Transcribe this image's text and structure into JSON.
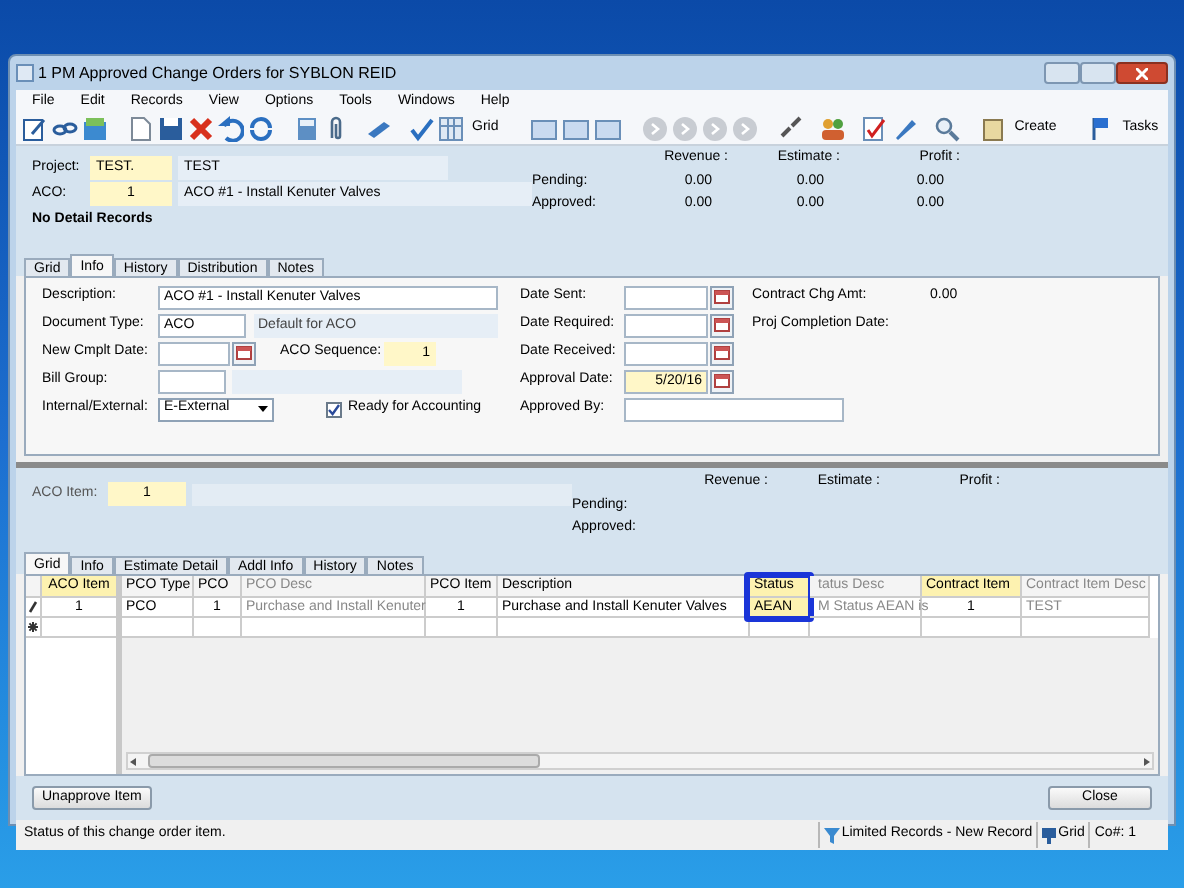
{
  "window": {
    "title": "1 PM Approved Change Orders for SYBLON REID"
  },
  "menu": [
    "File",
    "Edit",
    "Records",
    "View",
    "Options",
    "Tools",
    "Windows",
    "Help"
  ],
  "toolbar_labels": [
    "Grid",
    "Create",
    "Tasks"
  ],
  "header": {
    "project": {
      "label": "Project:",
      "code": "TEST.",
      "name": "TEST"
    },
    "aco": {
      "label": "ACO:",
      "code": "1",
      "name": "ACO #1 - Install Kenuter Valves"
    },
    "message": "No Detail Records",
    "totals": {
      "columns": [
        "Revenue :",
        "Estimate :",
        "Profit :"
      ],
      "rows": [
        {
          "label": "Pending:",
          "values": [
            "0.00",
            "0.00",
            "0.00"
          ]
        },
        {
          "label": "Approved:",
          "values": [
            "0.00",
            "0.00",
            "0.00"
          ]
        }
      ]
    }
  },
  "tabs": [
    {
      "label": "Grid",
      "selected": false
    },
    {
      "label": "Info",
      "selected": true
    },
    {
      "label": "History",
      "selected": false
    },
    {
      "label": "Distribution",
      "selected": false
    },
    {
      "label": "Notes",
      "selected": false
    }
  ],
  "info": {
    "description": {
      "label": "Description:",
      "value": "ACO #1 - Install Kenuter Valves"
    },
    "document_type": {
      "label": "Document Type:",
      "value": "ACO",
      "default_text": "Default for ACO"
    },
    "new_cmplt_date": {
      "label": "New Cmplt Date:"
    },
    "aco_sequence": {
      "label": "ACO Sequence:",
      "value": "1"
    },
    "bill_group": {
      "label": "Bill Group:"
    },
    "internal_external": {
      "label": "Internal/External:",
      "value": "E-External"
    },
    "ready_for_accounting": {
      "label": "Ready for Accounting",
      "checked": true
    },
    "date_sent": {
      "label": "Date Sent:"
    },
    "date_required": {
      "label": "Date Required:"
    },
    "date_received": {
      "label": "Date Received:"
    },
    "approval_date": {
      "label": "Approval Date:",
      "value": "5/20/16"
    },
    "approved_by": {
      "label": "Approved By:"
    },
    "contract_chg_amt": {
      "label": "Contract Chg Amt:",
      "value": "0.00"
    },
    "proj_completion_date": {
      "label": "Proj Completion Date:"
    }
  },
  "item": {
    "aco_item": {
      "label": "ACO Item:",
      "value": "1"
    },
    "totals": {
      "columns": [
        "Revenue :",
        "Estimate :",
        "Profit :"
      ],
      "rows": [
        "Pending:",
        "Approved:"
      ]
    }
  },
  "grid_tabs": [
    {
      "label": "Grid",
      "selected": true
    },
    {
      "label": "Info",
      "selected": false
    },
    {
      "label": "Estimate Detail",
      "selected": false
    },
    {
      "label": "Addl Info",
      "selected": false
    },
    {
      "label": "History",
      "selected": false
    },
    {
      "label": "Notes",
      "selected": false
    }
  ],
  "grid": {
    "frozen_column": {
      "label": "ACO Item",
      "kind": "required"
    },
    "columns": [
      {
        "label": "PCO Type",
        "kind": "normal",
        "highlighted": false
      },
      {
        "label": "PCO",
        "kind": "normal",
        "highlighted": false
      },
      {
        "label": "PCO Desc",
        "kind": "readonly",
        "highlighted": false
      },
      {
        "label": "PCO Item",
        "kind": "normal",
        "highlighted": false
      },
      {
        "label": "Description",
        "kind": "normal",
        "highlighted": false
      },
      {
        "label": "Status",
        "kind": "required",
        "highlighted": true
      },
      {
        "label": "tatus Desc",
        "kind": "readonly",
        "highlighted": false
      },
      {
        "label": "Contract Item",
        "kind": "required",
        "highlighted": false
      },
      {
        "label": "Contract Item Desc",
        "kind": "readonly",
        "highlighted": false
      }
    ],
    "rows": [
      {
        "kind": "editing",
        "aco_item": "1",
        "cells": [
          "PCO",
          "1",
          "Purchase and Install Kenuter",
          "1",
          "Purchase and Install Kenuter Valves",
          "AEAN",
          "M Status AEAN is",
          "1",
          "TEST"
        ]
      },
      {
        "kind": "new"
      }
    ]
  },
  "buttons": [
    "Unapprove Item",
    "Close"
  ],
  "status_bar": {
    "message": "Status of this change order item.",
    "panels": [
      {
        "kind": "filter",
        "text": "Limited Records - New Record"
      },
      {
        "kind": "grid",
        "text": "Grid"
      },
      {
        "kind": "plain",
        "text": "Co#: 1"
      }
    ]
  }
}
